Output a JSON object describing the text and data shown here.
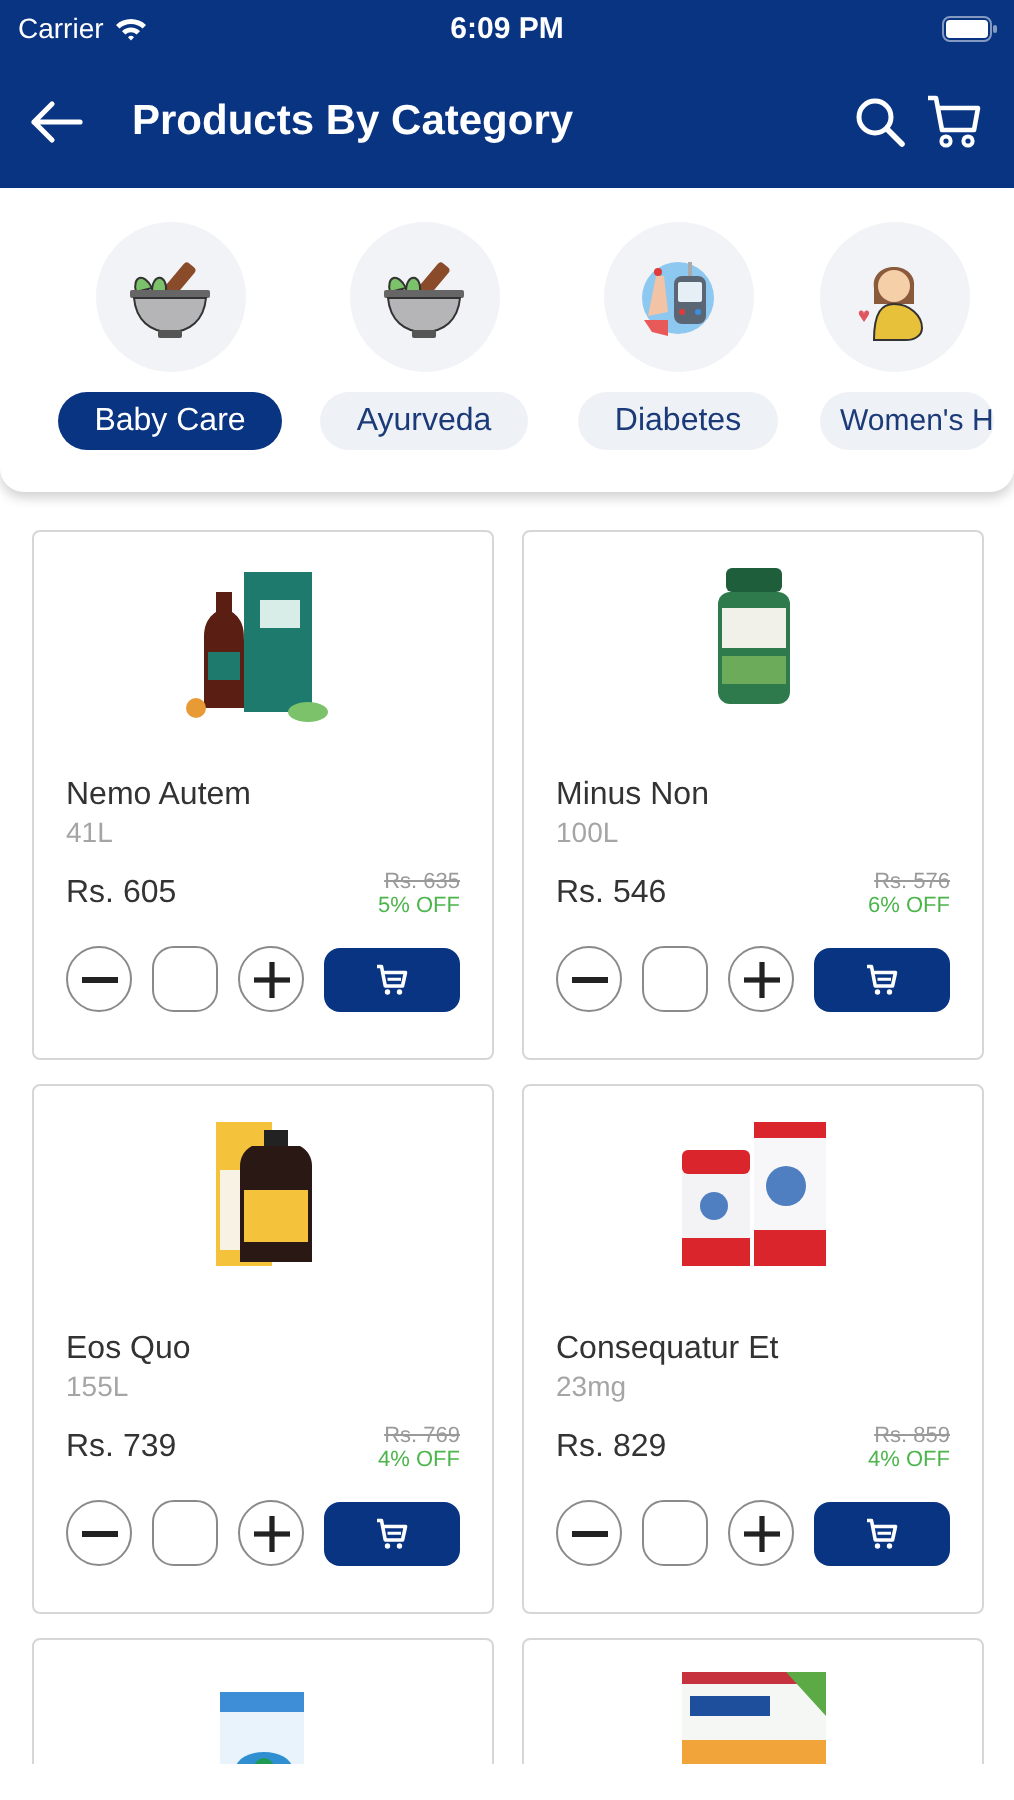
{
  "status_bar": {
    "carrier": "Carrier",
    "time": "6:09 PM"
  },
  "header": {
    "title": "Products By Category"
  },
  "categories": [
    {
      "kind": "mortar",
      "label": "Baby Care",
      "selected": true
    },
    {
      "kind": "mortar",
      "label": "Ayurveda",
      "selected": false
    },
    {
      "kind": "meter",
      "label": "Diabetes",
      "selected": false
    },
    {
      "kind": "woman",
      "label": "Women's H",
      "selected": false
    }
  ],
  "products": [
    {
      "kind": "bottle-box",
      "name": "Nemo Autem",
      "size": "41L",
      "price": "Rs. 605",
      "old_price": "Rs. 635",
      "discount": "5% OFF"
    },
    {
      "kind": "jar",
      "name": "Minus Non",
      "size": "100L",
      "price": "Rs. 546",
      "old_price": "Rs. 576",
      "discount": "6% OFF"
    },
    {
      "kind": "box-bottle",
      "name": "Eos Quo",
      "size": "155L",
      "price": "Rs. 739",
      "old_price": "Rs. 769",
      "discount": "4% OFF"
    },
    {
      "kind": "red-pack",
      "name": "Consequatur Et",
      "size": "23mg",
      "price": "Rs. 829",
      "old_price": "Rs. 859",
      "discount": "4% OFF"
    }
  ],
  "more_products": [
    {
      "kind": "blue-box"
    },
    {
      "kind": "flat-box"
    }
  ]
}
